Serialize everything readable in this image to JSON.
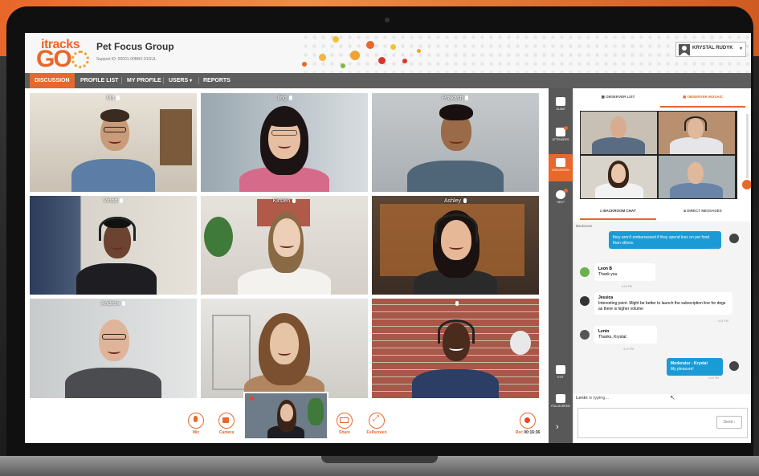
{
  "header": {
    "logo_top": "itracks",
    "logo_main": "GO",
    "title": "Pet Focus Group",
    "support": "Support ID: 00001-00BB2-01GUL",
    "user_name": "KRYSTAL RUDYK"
  },
  "nav": {
    "items": [
      "DISCUSSION",
      "PROFILE LIST",
      "MY PROFILE",
      "USERS",
      "REPORTS"
    ]
  },
  "participants": [
    "Mo",
    "Jing",
    "Prakash",
    "Vinod",
    "Kirsten",
    "Ashley",
    "Andrew",
    "",
    ""
  ],
  "controls": {
    "mic": "Mic",
    "camera": "Camera",
    "share": "Share",
    "fullscreen": "Fullscreen",
    "rec": "Rec",
    "rec_time": "00:16:36"
  },
  "rail": {
    "items": [
      "GUIDE",
      "ATTENDEES",
      "DISCUSSION",
      "HELP",
      "EXIT",
      "FULLSCREEN"
    ]
  },
  "right_panel": {
    "tab_observer_list": "OBSERVER LIST",
    "tab_observer_mosaic": "OBSERVER MOSAIC",
    "tab_backroom_chat": "BACKROOM CHAT",
    "tab_direct_messages": "DIRECT MESSAGES",
    "context_name": "Backroom",
    "messages": [
      {
        "name": "",
        "text": "they aren't embarrassed if they spend less on pet food than others.",
        "time": "4:09 PM",
        "own": true
      },
      {
        "name": "Leon B",
        "text": "Thank you",
        "time": "4:10 PM",
        "own": false
      },
      {
        "name": "Jessica",
        "text": "Interesting point. Might be better to launch the subscription line for dogs as there is higher volume",
        "time": "4:11 PM",
        "own": false
      },
      {
        "name": "Lenin",
        "text": "Thanks, Krystal.",
        "time": "4:12 PM",
        "own": false
      },
      {
        "name": "Moderator - Krystal",
        "text": "My pleasure!",
        "time": "4:13 PM",
        "own": true
      }
    ],
    "typing_name": "Lenin",
    "typing_suffix": "is typing...",
    "send": "Send"
  },
  "colors": {
    "accent": "#e8672a",
    "nav_bg": "#5e5e5e",
    "chat_bubble_own": "#1a9bd6"
  }
}
